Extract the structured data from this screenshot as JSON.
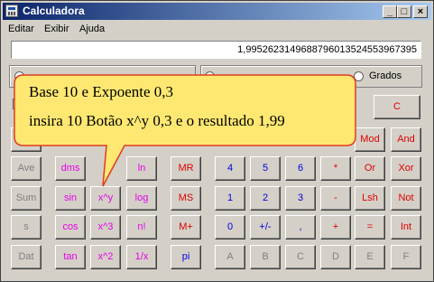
{
  "window": {
    "title": "Calculadora",
    "buttons": {
      "minimize": "_",
      "maximize": "□",
      "close": "×"
    }
  },
  "menu": [
    "Editar",
    "Exibir",
    "Ajuda"
  ],
  "display": {
    "value": "1,9952623149688796013524553967395"
  },
  "angle_units": {
    "selected_label": "Grados"
  },
  "buttons": {
    "row1": {
      "c": "C"
    },
    "row2": {
      "mod": "Mod",
      "and": "And"
    },
    "row3": {
      "ave": "Ave",
      "dms": "dms",
      "ln": "ln",
      "mr": "MR",
      "d4": "4",
      "d5": "5",
      "d6": "6",
      "mul": "*",
      "or": "Or",
      "xor": "Xor"
    },
    "row4": {
      "sum": "Sum",
      "sin": "sin",
      "xy": "x^y",
      "log": "log",
      "ms": "MS",
      "d1": "1",
      "d2": "2",
      "d3": "3",
      "sub": "-",
      "lsh": "Lsh",
      "not": "Not"
    },
    "row5": {
      "s": "s",
      "cos": "cos",
      "x3": "x^3",
      "fact": "n!",
      "mplus": "M+",
      "d0": "0",
      "sign": "+/-",
      "dot": ",",
      "add": "+",
      "eq": "=",
      "int": "Int"
    },
    "row6": {
      "dat": "Dat",
      "tan": "tan",
      "x2": "x^2",
      "recip": "1/x",
      "pi": "pi",
      "a": "A",
      "b": "B",
      "c": "C",
      "d": "D",
      "e": "E",
      "f": "F"
    }
  },
  "tooltip": {
    "line1": "Base 10 e Expoente 0,3",
    "line2": "insira 10 Botão x^y 0,3 e o resultado 1,99"
  },
  "colors": {
    "title_bar": "#0a246a",
    "window": "#d4d0c8",
    "tooltip_fill": "#ffe872",
    "tooltip_border": "#e13b1e"
  }
}
